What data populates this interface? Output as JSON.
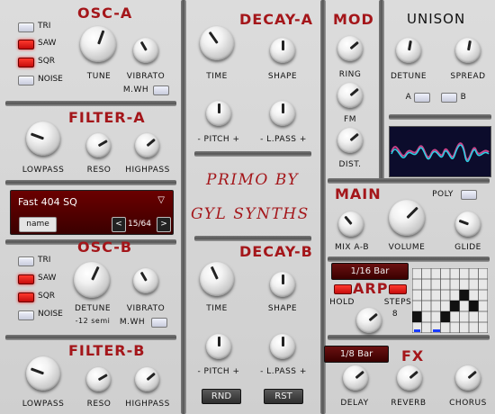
{
  "osc_a": {
    "title": "OSC-A",
    "waves": [
      {
        "label": "TRI",
        "on": false
      },
      {
        "label": "SAW",
        "on": true
      },
      {
        "label": "SQR",
        "on": true
      },
      {
        "label": "NOISE",
        "on": false
      }
    ],
    "tune_label": "TUNE",
    "vibrato_label": "VIBRATO",
    "mwh_label": "M.WH"
  },
  "filter_a": {
    "title": "FILTER-A",
    "lowpass": "LOWPASS",
    "reso": "RESO",
    "highpass": "HIGHPASS"
  },
  "preset": {
    "name": "Fast 404 SQ",
    "arrow": "▽",
    "name_button": "name",
    "prev": "<",
    "next": ">",
    "counter": "15/64"
  },
  "osc_b": {
    "title": "OSC-B",
    "waves": [
      {
        "label": "TRI",
        "on": false
      },
      {
        "label": "SAW",
        "on": true
      },
      {
        "label": "SQR",
        "on": true
      },
      {
        "label": "NOISE",
        "on": false
      }
    ],
    "detune_label": "DETUNE",
    "detune_value": "-12 semi",
    "vibrato_label": "VIBRATO",
    "mwh_label": "M.WH"
  },
  "filter_b": {
    "title": "FILTER-B",
    "lowpass": "LOWPASS",
    "reso": "RESO",
    "highpass": "HIGHPASS"
  },
  "decay_a": {
    "title": "DECAY-A",
    "time": "TIME",
    "shape": "SHAPE",
    "pitch": "- PITCH +",
    "lpass": "- L.PASS +"
  },
  "branding": {
    "line1": "PRIMO BY",
    "line2": "GYL SYNTHS"
  },
  "decay_b": {
    "title": "DECAY-B",
    "time": "TIME",
    "shape": "SHAPE",
    "pitch": "- PITCH +",
    "lpass": "- L.PASS +"
  },
  "buttons": {
    "rnd": "RND",
    "rst": "RST"
  },
  "mod": {
    "title": "MOD",
    "ring": "RING",
    "fm": "FM",
    "dist": "DIST."
  },
  "unison": {
    "title": "UNISON",
    "detune": "DETUNE",
    "spread": "SPREAD",
    "a": "A",
    "b": "B"
  },
  "main": {
    "title": "MAIN",
    "poly": "POLY",
    "mix": "MIX A-B",
    "volume": "VOLUME",
    "glide": "GLIDE"
  },
  "arp": {
    "rate": "1/16 Bar",
    "title": "ARP",
    "hold": "HOLD",
    "steps_label": "STEPS",
    "steps_value": "8"
  },
  "fx": {
    "rate": "1/8 Bar",
    "title": "FX",
    "delay": "DELAY",
    "reverb": "REVERB",
    "chorus": "CHORUS"
  },
  "colors": {
    "accent": "#a4161a",
    "panel": "#d4d4d4",
    "led_on": "#e01a12",
    "display_bg": "#4a0000"
  }
}
